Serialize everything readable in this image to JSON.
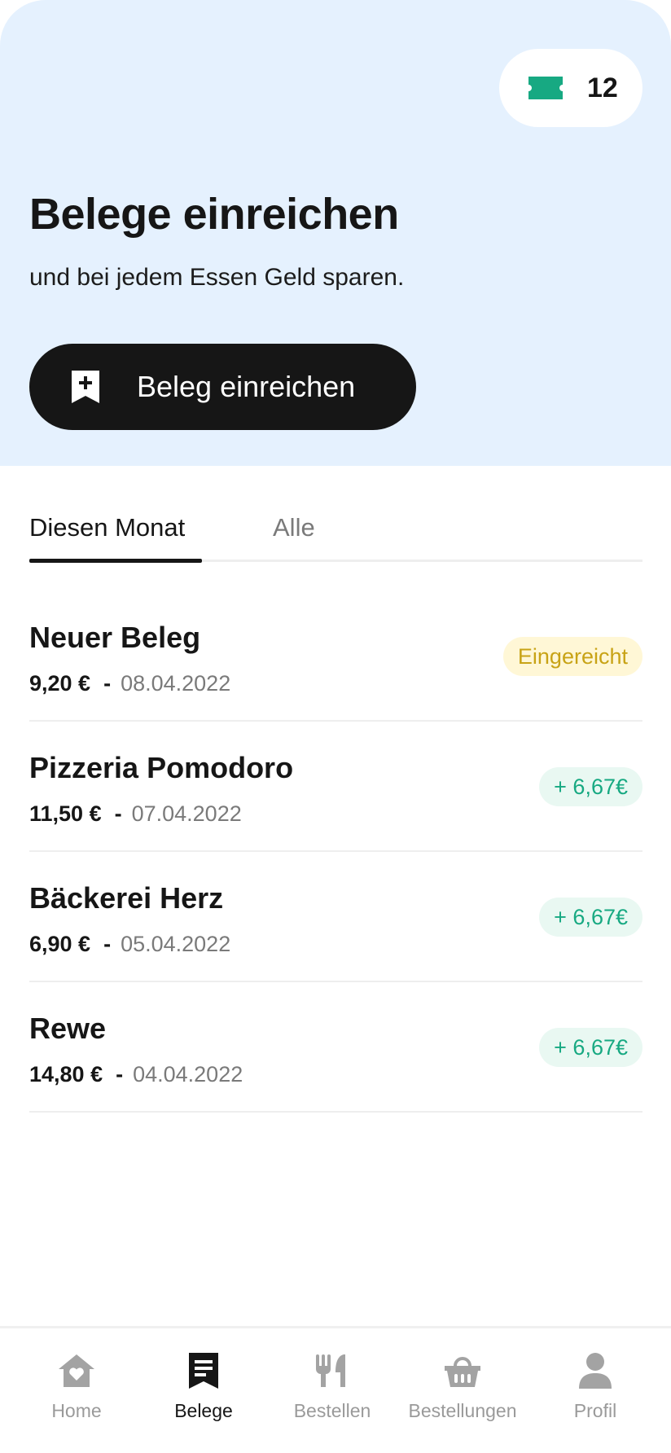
{
  "header": {
    "ticket_icon": "ticket-icon",
    "ticket_count": "12",
    "title": "Belege einreichen",
    "subtitle": "und bei jedem Essen Geld sparen.",
    "submit_button": {
      "icon": "receipt-add-icon",
      "label": "Beleg einreichen"
    }
  },
  "tabs": [
    {
      "label": "Diesen Monat",
      "active": true
    },
    {
      "label": "Alle",
      "active": false
    }
  ],
  "receipts": [
    {
      "name": "Neuer Beleg",
      "amount": "9,20 €",
      "separator": "-",
      "date": "08.04.2022",
      "status": "Eingereicht",
      "status_type": "pending"
    },
    {
      "name": "Pizzeria Pomodoro",
      "amount": "11,50 €",
      "separator": "-",
      "date": "07.04.2022",
      "status": "+ 6,67€",
      "status_type": "credit"
    },
    {
      "name": "Bäckerei Herz",
      "amount": "6,90 €",
      "separator": "-",
      "date": "05.04.2022",
      "status": "+ 6,67€",
      "status_type": "credit"
    },
    {
      "name": "Rewe",
      "amount": "14,80 €",
      "separator": "-",
      "date": "04.04.2022",
      "status": "+ 6,67€",
      "status_type": "credit"
    }
  ],
  "bottom_nav": [
    {
      "label": "Home",
      "icon": "home-heart-icon",
      "active": false
    },
    {
      "label": "Belege",
      "icon": "receipt-icon",
      "active": true
    },
    {
      "label": "Bestellen",
      "icon": "fork-knife-icon",
      "active": false
    },
    {
      "label": "Bestellungen",
      "icon": "basket-icon",
      "active": false
    },
    {
      "label": "Profil",
      "icon": "user-icon",
      "active": false
    }
  ],
  "colors": {
    "hero_bg": "#e5f1fe",
    "primary_dark": "#161616",
    "accent_green": "#17a982",
    "pending_yellow": "#c8a316",
    "muted_grey": "#9a9a9a"
  }
}
